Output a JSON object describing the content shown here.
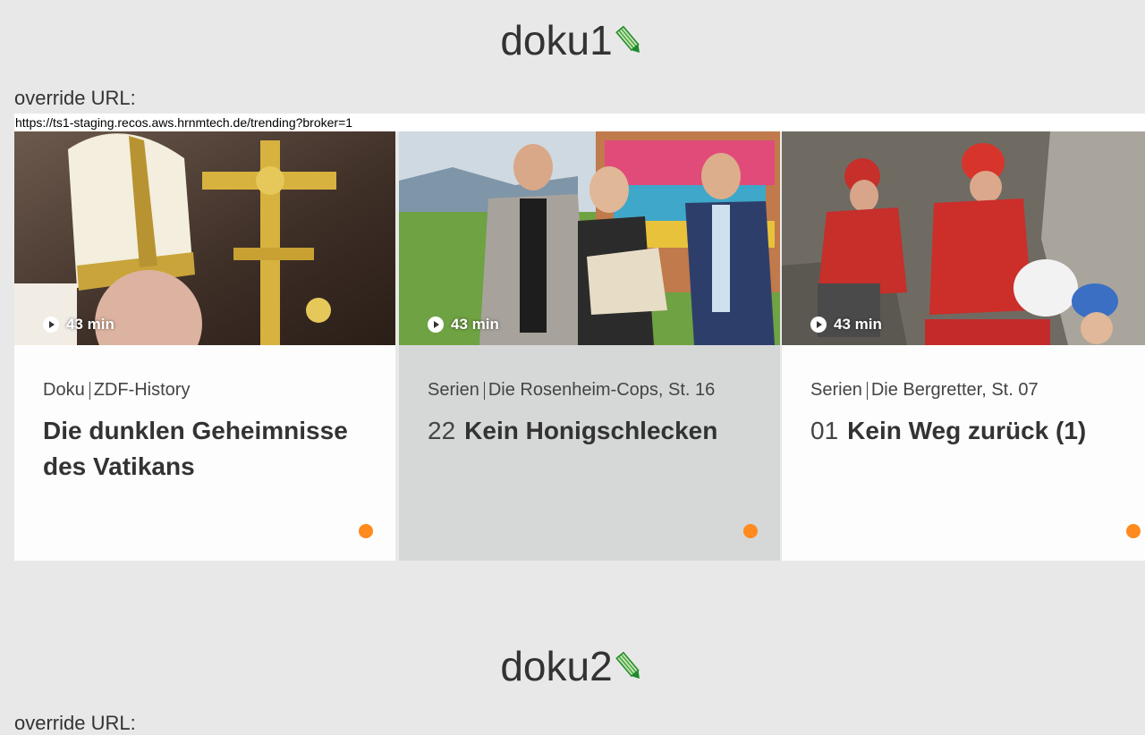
{
  "sections": [
    {
      "title": "doku1",
      "override_label": "override URL:",
      "override_url": "https://ts1-staging.recos.aws.hrnmtech.de/trending?broker=1"
    },
    {
      "title": "doku2",
      "override_label": "override URL:"
    }
  ],
  "cards": [
    {
      "duration": "43 min",
      "category": "Doku",
      "channel": "ZDF-History",
      "episode": "",
      "title": "Die dunklen Geheimnisse des Vatikans"
    },
    {
      "duration": "43 min",
      "category": "Serien",
      "channel": "Die Rosenheim-Cops, St. 16",
      "episode": "22",
      "title": "Kein Honigschlecken"
    },
    {
      "duration": "43 min",
      "category": "Serien",
      "channel": "Die Bergretter, St. 07",
      "episode": "01",
      "title": "Kein Weg zurück (1)"
    }
  ],
  "icons": {
    "edit": "pencil-icon",
    "play": "play-icon",
    "status": "orange-dot"
  },
  "colors": {
    "background": "#e8e8e8",
    "card": "#fdfdfd",
    "card_highlight": "#d6d8d8",
    "accent_dot": "#ff8a1e",
    "pencil": "#1e8a2a"
  }
}
